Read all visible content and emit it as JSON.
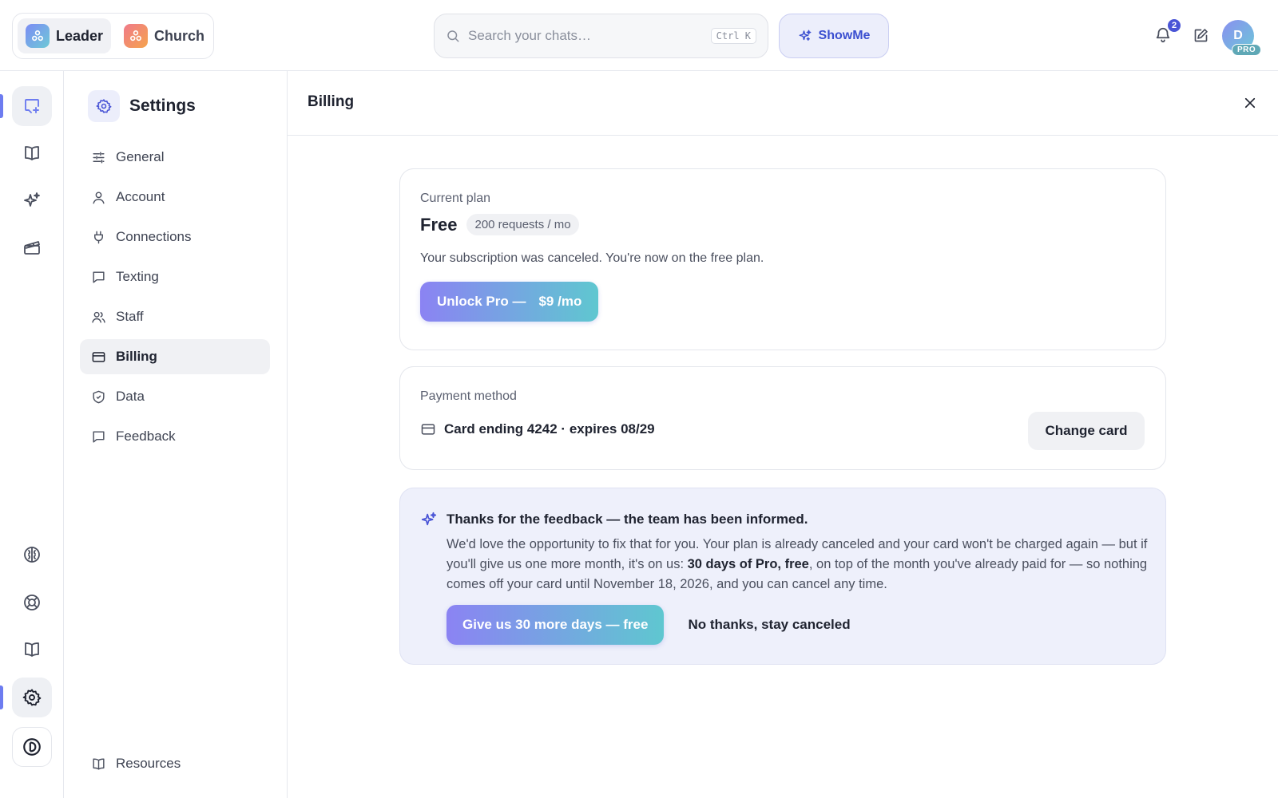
{
  "workspaces": [
    {
      "label": "Leader",
      "active": true
    },
    {
      "label": "Church",
      "active": false
    }
  ],
  "search": {
    "placeholder": "Search your chats…",
    "shortcut": "Ctrl K"
  },
  "showme": {
    "label": "ShowMe"
  },
  "notifications": {
    "count": "2"
  },
  "user": {
    "initial": "D",
    "tier": "PRO"
  },
  "rail": {
    "top": [
      "new-chat-icon",
      "book-icon",
      "sparkles-icon",
      "clapperboard-icon"
    ],
    "bottom": [
      "brain-icon",
      "lifebuoy-icon",
      "book-icon",
      "gear-icon",
      "brand-icon"
    ]
  },
  "settings_nav": {
    "title": "Settings",
    "items": [
      {
        "label": "General",
        "icon": "sliders-icon"
      },
      {
        "label": "Account",
        "icon": "user-icon"
      },
      {
        "label": "Connections",
        "icon": "plug-icon"
      },
      {
        "label": "Texting",
        "icon": "message-icon"
      },
      {
        "label": "Staff",
        "icon": "users-icon"
      },
      {
        "label": "Billing",
        "icon": "credit-card-icon",
        "active": true
      },
      {
        "label": "Data",
        "icon": "shield-icon"
      },
      {
        "label": "Feedback",
        "icon": "message-icon"
      }
    ],
    "footer": {
      "label": "Resources",
      "icon": "book-icon"
    }
  },
  "main": {
    "title": "Billing",
    "plan": {
      "label": "Current plan",
      "name": "Free",
      "quota": "200 requests / mo",
      "description": "Your subscription was canceled. You're now on the free plan.",
      "upgrade_label": "Unlock Pro —",
      "upgrade_price": "$9 /mo"
    },
    "payment": {
      "label": "Payment method",
      "card_text": "Card ending 4242 · expires 08/29",
      "change_label": "Change card"
    },
    "offer": {
      "title": "Thanks for the feedback — the team has been informed.",
      "body_pre": "We'd love the opportunity to fix that for you. Your plan is already canceled and your card won't be charged again — but if you'll give us one more month, it's on us: ",
      "body_bold": "30 days of Pro, free",
      "body_post": ", on top of the month you've already paid for — so nothing comes off your card until November 18, 2026, and you can cancel any time.",
      "accept_label": "Give us 30 more days — free",
      "decline_label": "No thanks, stay canceled"
    }
  },
  "colors": {
    "accent": "#6d7cf0",
    "brand_gradient_start": "#8b83f3",
    "brand_gradient_end": "#5fc7d0",
    "offer_bg": "#eef0fb"
  }
}
